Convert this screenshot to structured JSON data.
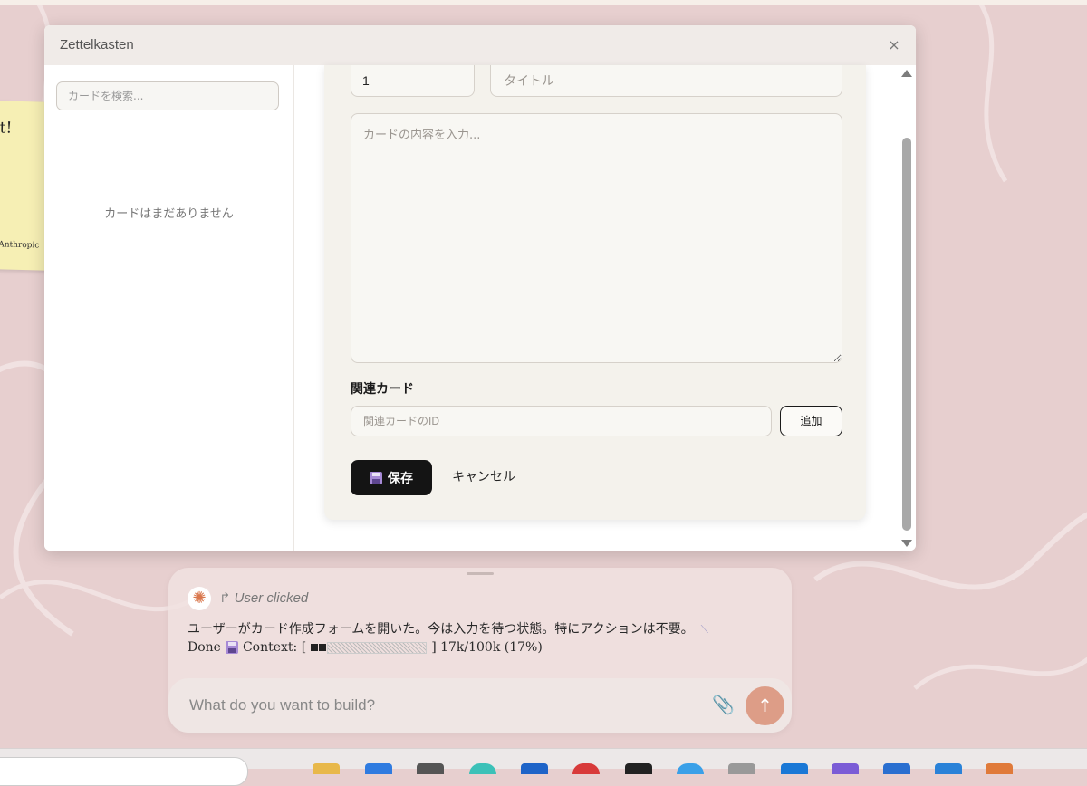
{
  "window": {
    "title": "Zettelkasten",
    "close_glyph": "×"
  },
  "sidebar": {
    "search_placeholder": "カードを検索...",
    "empty_message": "カードはまだありません"
  },
  "form": {
    "id_value": "1",
    "title_placeholder": "タイトル",
    "body_placeholder": "カードの内容を入力...",
    "related_label": "関連カード",
    "related_placeholder": "関連カードのID",
    "add_label": "追加",
    "save_label": "保存",
    "cancel_label": "キャンセル"
  },
  "sticky_note": {
    "text_top": "t!",
    "text_bottom": "Anthropic"
  },
  "chat": {
    "event_label": "User clicked",
    "message_line1": "ユーザーがカード作成フォームを開いた。今は入力を待つ状態。特にアクションは不要。",
    "done_label": "Done",
    "context_label": "Context: [",
    "context_tail": "] 17k/100k (17%)",
    "context_usage": 0.17,
    "input_placeholder": "What do you want to build?",
    "send_glyph": "↑"
  },
  "icons": {
    "close": "close-icon",
    "floppy": "floppy-disk-icon",
    "claude": "claude-logo-icon",
    "arrow": "reply-arrow-icon",
    "attach": "paperclip-icon",
    "send": "arrow-up-icon"
  },
  "colors": {
    "save_button_bg": "#141414",
    "send_button_bg": "#dd9d87",
    "desktop_bg": "#e7cfcf",
    "sticky_note": "#f6efb4"
  }
}
